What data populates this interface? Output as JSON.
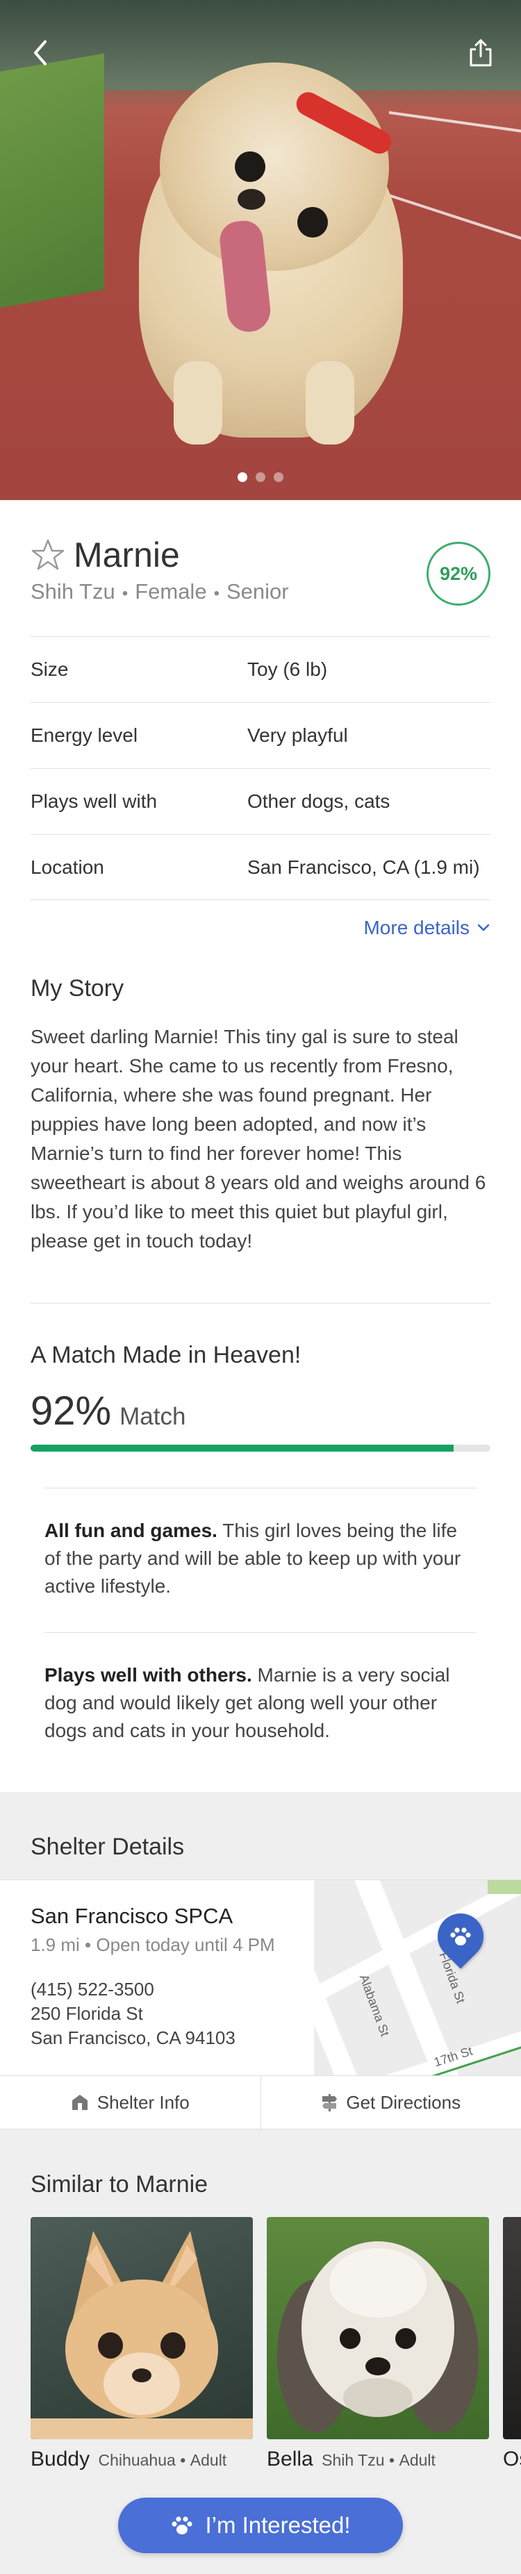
{
  "colors": {
    "accent": "#4a6fd6",
    "link": "#3b64c7",
    "match_green": "#16a164"
  },
  "hero": {
    "photo_icon": "dog-photo",
    "back_icon": "chevron-left-icon",
    "share_icon": "share-icon",
    "carousel_pages": 3,
    "carousel_active": 1
  },
  "pet": {
    "name": "Marnie",
    "favorite_icon": "star-outline-icon",
    "breed": "Shih Tzu",
    "sex": "Female",
    "age": "Senior",
    "separator": "•",
    "match_badge": "92%"
  },
  "attributes": [
    {
      "label": "Size",
      "value": "Toy (6 lb)"
    },
    {
      "label": "Energy level",
      "value": "Very playful"
    },
    {
      "label": "Plays well with",
      "value": "Other dogs, cats"
    },
    {
      "label": "Location",
      "value": "San Francisco, CA (1.9 mi)"
    }
  ],
  "more_details": {
    "label": "More details",
    "icon": "chevron-down-icon"
  },
  "story": {
    "title": "My Story",
    "text": "Sweet darling Marnie! This tiny gal is sure to steal your heart. She came to us recently from Fresno, California, where she was found pregnant. Her puppies have long been adopted, and now it’s Marnie’s turn to find her forever home! This sweetheart is about 8 years old and weighs around 6 lbs. If you’d like to meet this quiet but playful girl, please get in touch today!"
  },
  "match": {
    "title": "A Match Made in Heaven!",
    "percent": "92%",
    "word": "Match",
    "progress": 0.92,
    "traits": [
      {
        "heading": "All fun and games.",
        "text": " This girl loves being the life of the party and will be able to keep up with your active lifestyle."
      },
      {
        "heading": "Plays well with others.",
        "text": " Marnie is a very social dog and would likely get along well your other dogs and cats in your household."
      }
    ]
  },
  "shelter": {
    "section_title": "Shelter Details",
    "name": "San Francisco SPCA",
    "distance": "1.9 mi",
    "hours": "Open today until 4 PM",
    "phone": "(415) 522-3500",
    "street": "250 Florida St",
    "city": "San Francisco, CA 94103",
    "map": {
      "street_1": "Florida St",
      "street_2": "Alabama St",
      "street_3": "17th St",
      "pin_icon": "paw-pin-icon"
    },
    "info_button": {
      "label": "Shelter Info",
      "icon": "building-icon"
    },
    "directions_button": {
      "label": "Get Directions",
      "icon": "signpost-icon"
    }
  },
  "similar": {
    "title": "Similar to Marnie",
    "items": [
      {
        "name": "Buddy",
        "breed": "Chihuahua",
        "age": "Adult"
      },
      {
        "name": "Bella",
        "breed": "Shih Tzu",
        "age": "Adult"
      },
      {
        "name": "Os"
      }
    ]
  },
  "cta": {
    "label": "I’m Interested!",
    "icon": "paw-icon"
  }
}
